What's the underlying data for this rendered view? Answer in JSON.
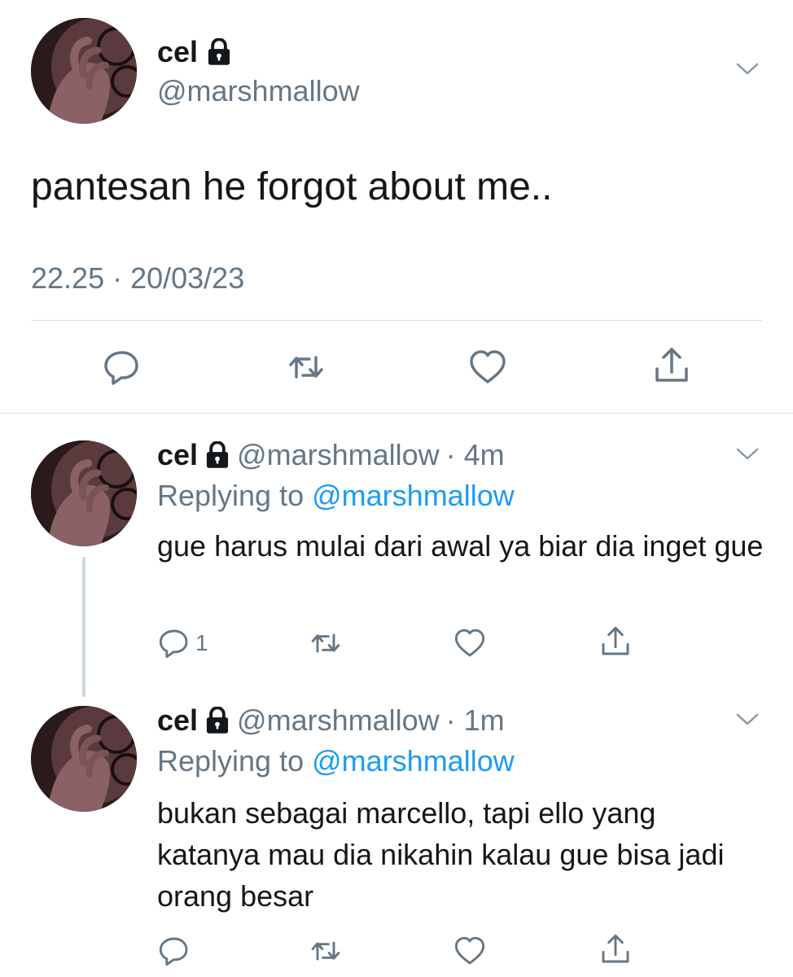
{
  "main_tweet": {
    "name": "cel",
    "handle": "@marshmallow",
    "text": "pantesan he forgot about me..",
    "time": "22.25",
    "separator": "·",
    "date": "20/03/23"
  },
  "replies": [
    {
      "name": "cel",
      "handle": "@marshmallow",
      "age": "· 4m",
      "replying_prefix": "Replying to",
      "replying_handle": "@marshmallow",
      "text": "gue harus mulai dari awal ya biar dia inget gue",
      "reply_count": "1"
    },
    {
      "name": "cel",
      "handle": "@marshmallow",
      "age": "· 1m",
      "replying_prefix": "Replying to",
      "replying_handle": "@marshmallow",
      "text": "bukan sebagai marcello, tapi ello yang katanya mau dia nikahin kalau gue bisa jadi orang besar",
      "reply_count": ""
    }
  ],
  "colors": {
    "text": "#14171a",
    "muted": "#657786",
    "link": "#1d9bf0",
    "divider": "#d9dee3",
    "thread_line": "#ccd6dd"
  },
  "icons": [
    "lock-icon",
    "chevron-down-icon",
    "reply-icon",
    "retweet-icon",
    "like-icon",
    "share-icon"
  ]
}
